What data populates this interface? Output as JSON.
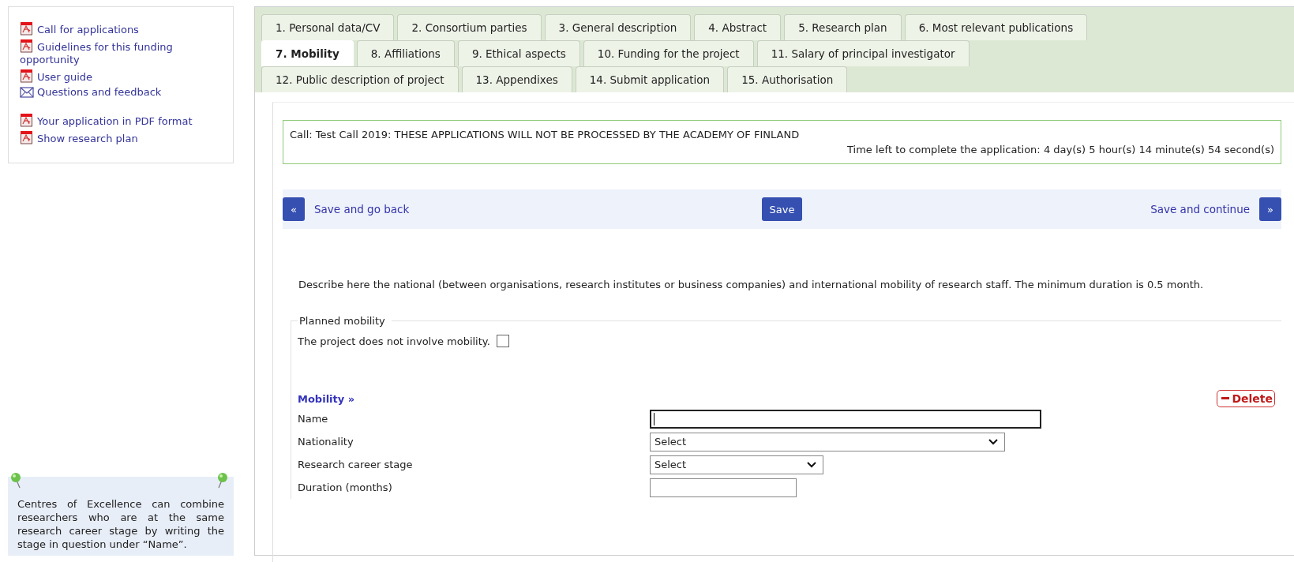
{
  "sidebar": {
    "link_groups": [
      {
        "links": [
          {
            "label": "Call for applications",
            "kind": "pdf"
          },
          {
            "label": "Guidelines for this funding opportunity",
            "kind": "pdf"
          },
          {
            "label": "User guide",
            "kind": "pdf"
          },
          {
            "label": "Questions and feedback",
            "kind": "mail"
          }
        ]
      },
      {
        "links": [
          {
            "label": "Your application in PDF format",
            "kind": "pdf"
          },
          {
            "label": "Show research plan",
            "kind": "pdf"
          }
        ]
      }
    ],
    "tip": {
      "text": "Centres of Excellence can combine researchers who are at the same research career stage by writing the stage in question under “Name”."
    }
  },
  "tabs": {
    "rows": [
      {
        "tabs": [
          {
            "label": "1. Personal data/CV",
            "selected": false
          },
          {
            "label": "2. Consortium parties",
            "selected": false
          },
          {
            "label": "3. General description",
            "selected": false
          },
          {
            "label": "4. Abstract",
            "selected": false
          },
          {
            "label": "5. Research plan",
            "selected": false
          },
          {
            "label": "6. Most relevant publications",
            "selected": false
          }
        ]
      },
      {
        "tabs": [
          {
            "label": "7. Mobility",
            "selected": true
          },
          {
            "label": "8. Affiliations",
            "selected": false
          },
          {
            "label": "9. Ethical aspects",
            "selected": false
          },
          {
            "label": "10. Funding for the project",
            "selected": false
          },
          {
            "label": "11. Salary of principal investigator",
            "selected": false
          }
        ]
      },
      {
        "tabs": [
          {
            "label": "12. Public description of project",
            "selected": false
          },
          {
            "label": "13. Appendixes",
            "selected": false
          },
          {
            "label": "14. Submit application",
            "selected": false
          },
          {
            "label": "15. Authorisation",
            "selected": false
          }
        ]
      }
    ]
  },
  "call_info": {
    "call": "Call: Test Call 2019: THESE APPLICATIONS WILL NOT BE PROCESSED BY THE ACADEMY OF FINLAND",
    "time_left": "Time left to complete the application: 4 day(s) 5 hour(s) 14 minute(s) 54 second(s)"
  },
  "nav": {
    "back_icon": "«",
    "back_label": "Save and go back",
    "save_label": "Save",
    "continue_label": "Save and continue",
    "forward_icon": "»"
  },
  "description": "Describe here the national (between organisations, research institutes or business companies) and international mobility of research staff. The minimum duration is 0.5 month.",
  "planned_mobility": {
    "legend": "Planned mobility",
    "checkbox": {
      "label": "The project does not involve mobility.",
      "checked": false
    }
  },
  "mobility": {
    "heading": "Mobility »",
    "delete_label": "Delete",
    "fields": [
      {
        "label": "Name",
        "kind": "text",
        "focused": true
      },
      {
        "label": "Nationality",
        "kind": "select",
        "value": "Select"
      },
      {
        "label": "Research career stage",
        "kind": "select",
        "value": "Select"
      },
      {
        "label": "Duration (months)",
        "kind": "text",
        "focused": false
      }
    ]
  }
}
